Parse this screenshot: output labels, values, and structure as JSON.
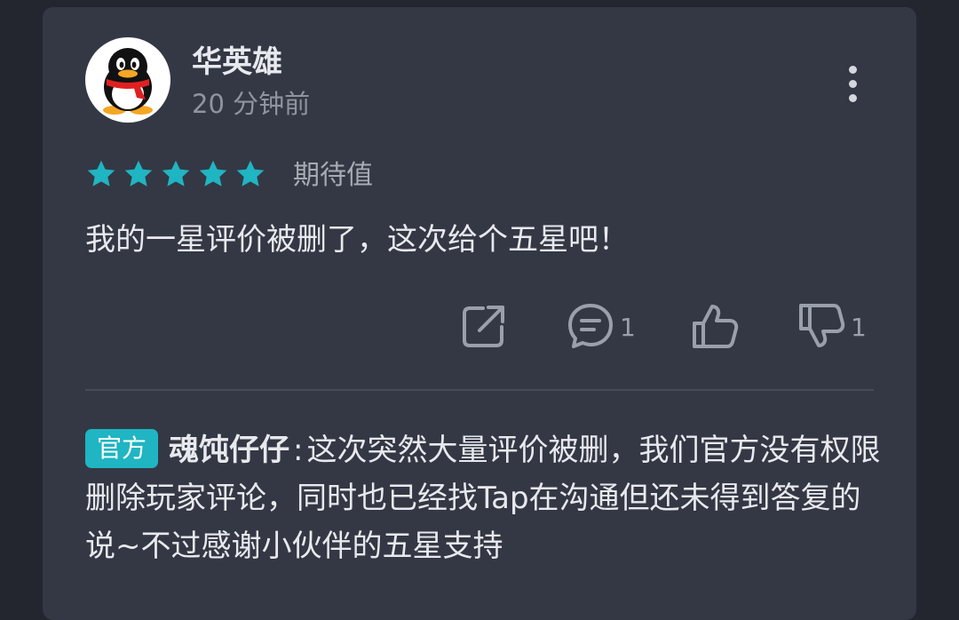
{
  "review": {
    "user": {
      "name": "华英雄",
      "time": "20 分钟前",
      "avatar_icon": "qq-penguin-icon"
    },
    "rating": {
      "stars": 5,
      "max_stars": 5,
      "star_color": "#1fb5c2",
      "label": "期待值"
    },
    "content": "我的一星评价被删了，这次给个五星吧！",
    "actions": {
      "share_icon": "share-icon",
      "comment_icon": "comment-icon",
      "comment_count": "1",
      "like_icon": "thumbs-up-icon",
      "dislike_icon": "thumbs-down-icon",
      "dislike_count": "1"
    },
    "official_reply": {
      "badge": "官方",
      "badge_color": "#1fb5c2",
      "author": "魂饨仔仔",
      "separator": ":",
      "text": "这次突然大量评价被删，我们官方没有权限删除玩家评论，同时也已经找Tap在沟通但还未得到答复的说~不过感谢小伙伴的五星支持"
    }
  }
}
